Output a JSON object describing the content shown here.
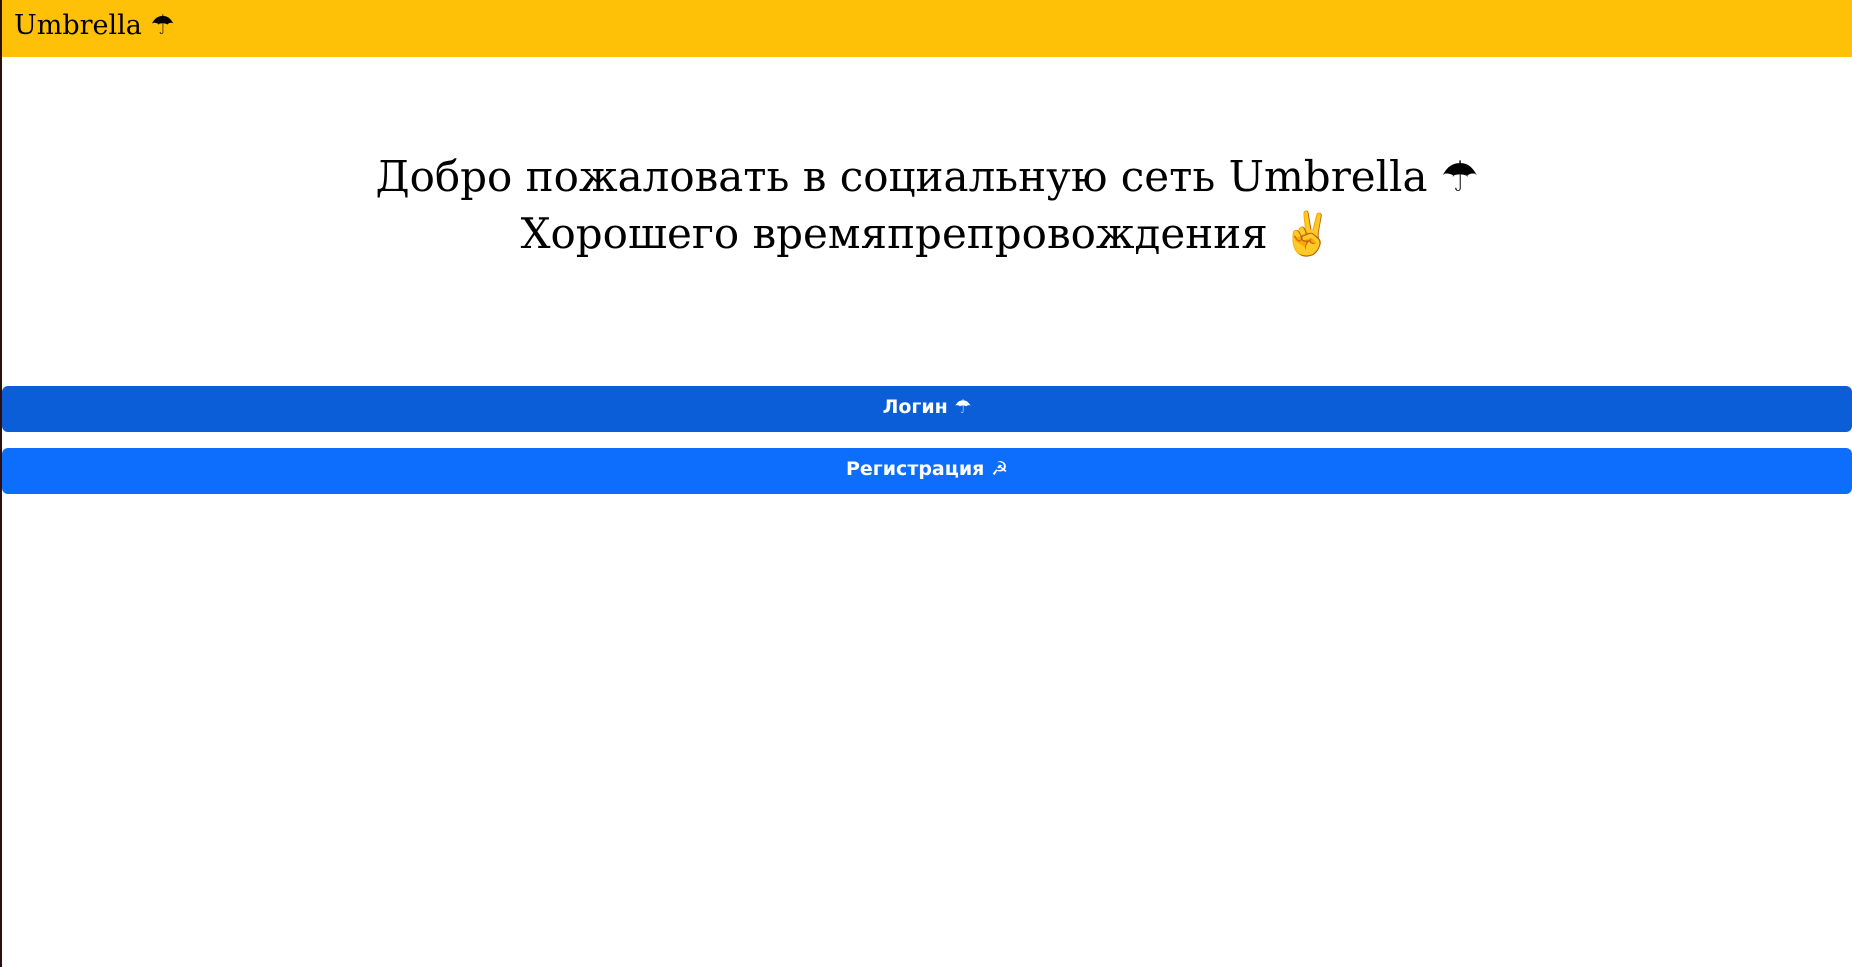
{
  "header": {
    "brand": "Umbrella ☂"
  },
  "welcome": {
    "line1": "Добро пожаловать в социальную сеть Umbrella ☂",
    "line2": "Хорошего времяпрепровождения ✌"
  },
  "buttons": {
    "login_label": "Логин ☂",
    "register_label": "Регистрация ☭"
  },
  "colors": {
    "header_bg": "#ffc107",
    "login_bg": "#0b5ed7",
    "register_bg": "#0d6efd"
  }
}
